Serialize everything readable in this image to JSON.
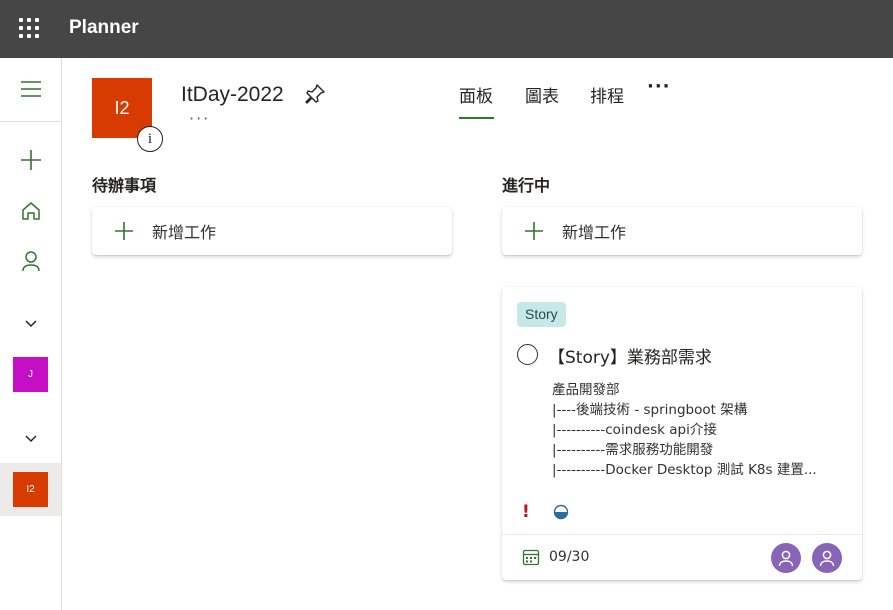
{
  "app": {
    "title": "Planner"
  },
  "rail": {
    "plans": [
      {
        "initials": "J",
        "color": "#c40fc4"
      },
      {
        "initials": "I2",
        "color": "#d83b01"
      }
    ]
  },
  "plan": {
    "initials": "I2",
    "logo_color": "#d83b01",
    "name": "ItDay-2022",
    "info_glyph": "i",
    "more_glyph": "···"
  },
  "tabs": [
    {
      "label": "面板",
      "active": true
    },
    {
      "label": "圖表",
      "active": false
    },
    {
      "label": "排程",
      "active": false
    }
  ],
  "tabs_more": "···",
  "buckets": [
    {
      "title": "待辦事項",
      "add_label": "新增工作"
    },
    {
      "title": "進行中",
      "add_label": "新增工作"
    }
  ],
  "task": {
    "label": "Story",
    "label_color": "#c6e8e8",
    "title": "【Story】業務部需求",
    "description": [
      "產品開發部",
      "|----後端技術 - springboot 架構",
      "|----------coindesk api介接",
      "|----------需求服務功能開發",
      "|----------Docker Desktop 測試 K8s 建置..."
    ],
    "priority_glyph": "!",
    "priority_color": "#c50f1f",
    "progress": 0.5,
    "due": "09/30",
    "assignee_count": 2,
    "avatar_color": "#8764b8"
  },
  "accent_color": "#31752f"
}
